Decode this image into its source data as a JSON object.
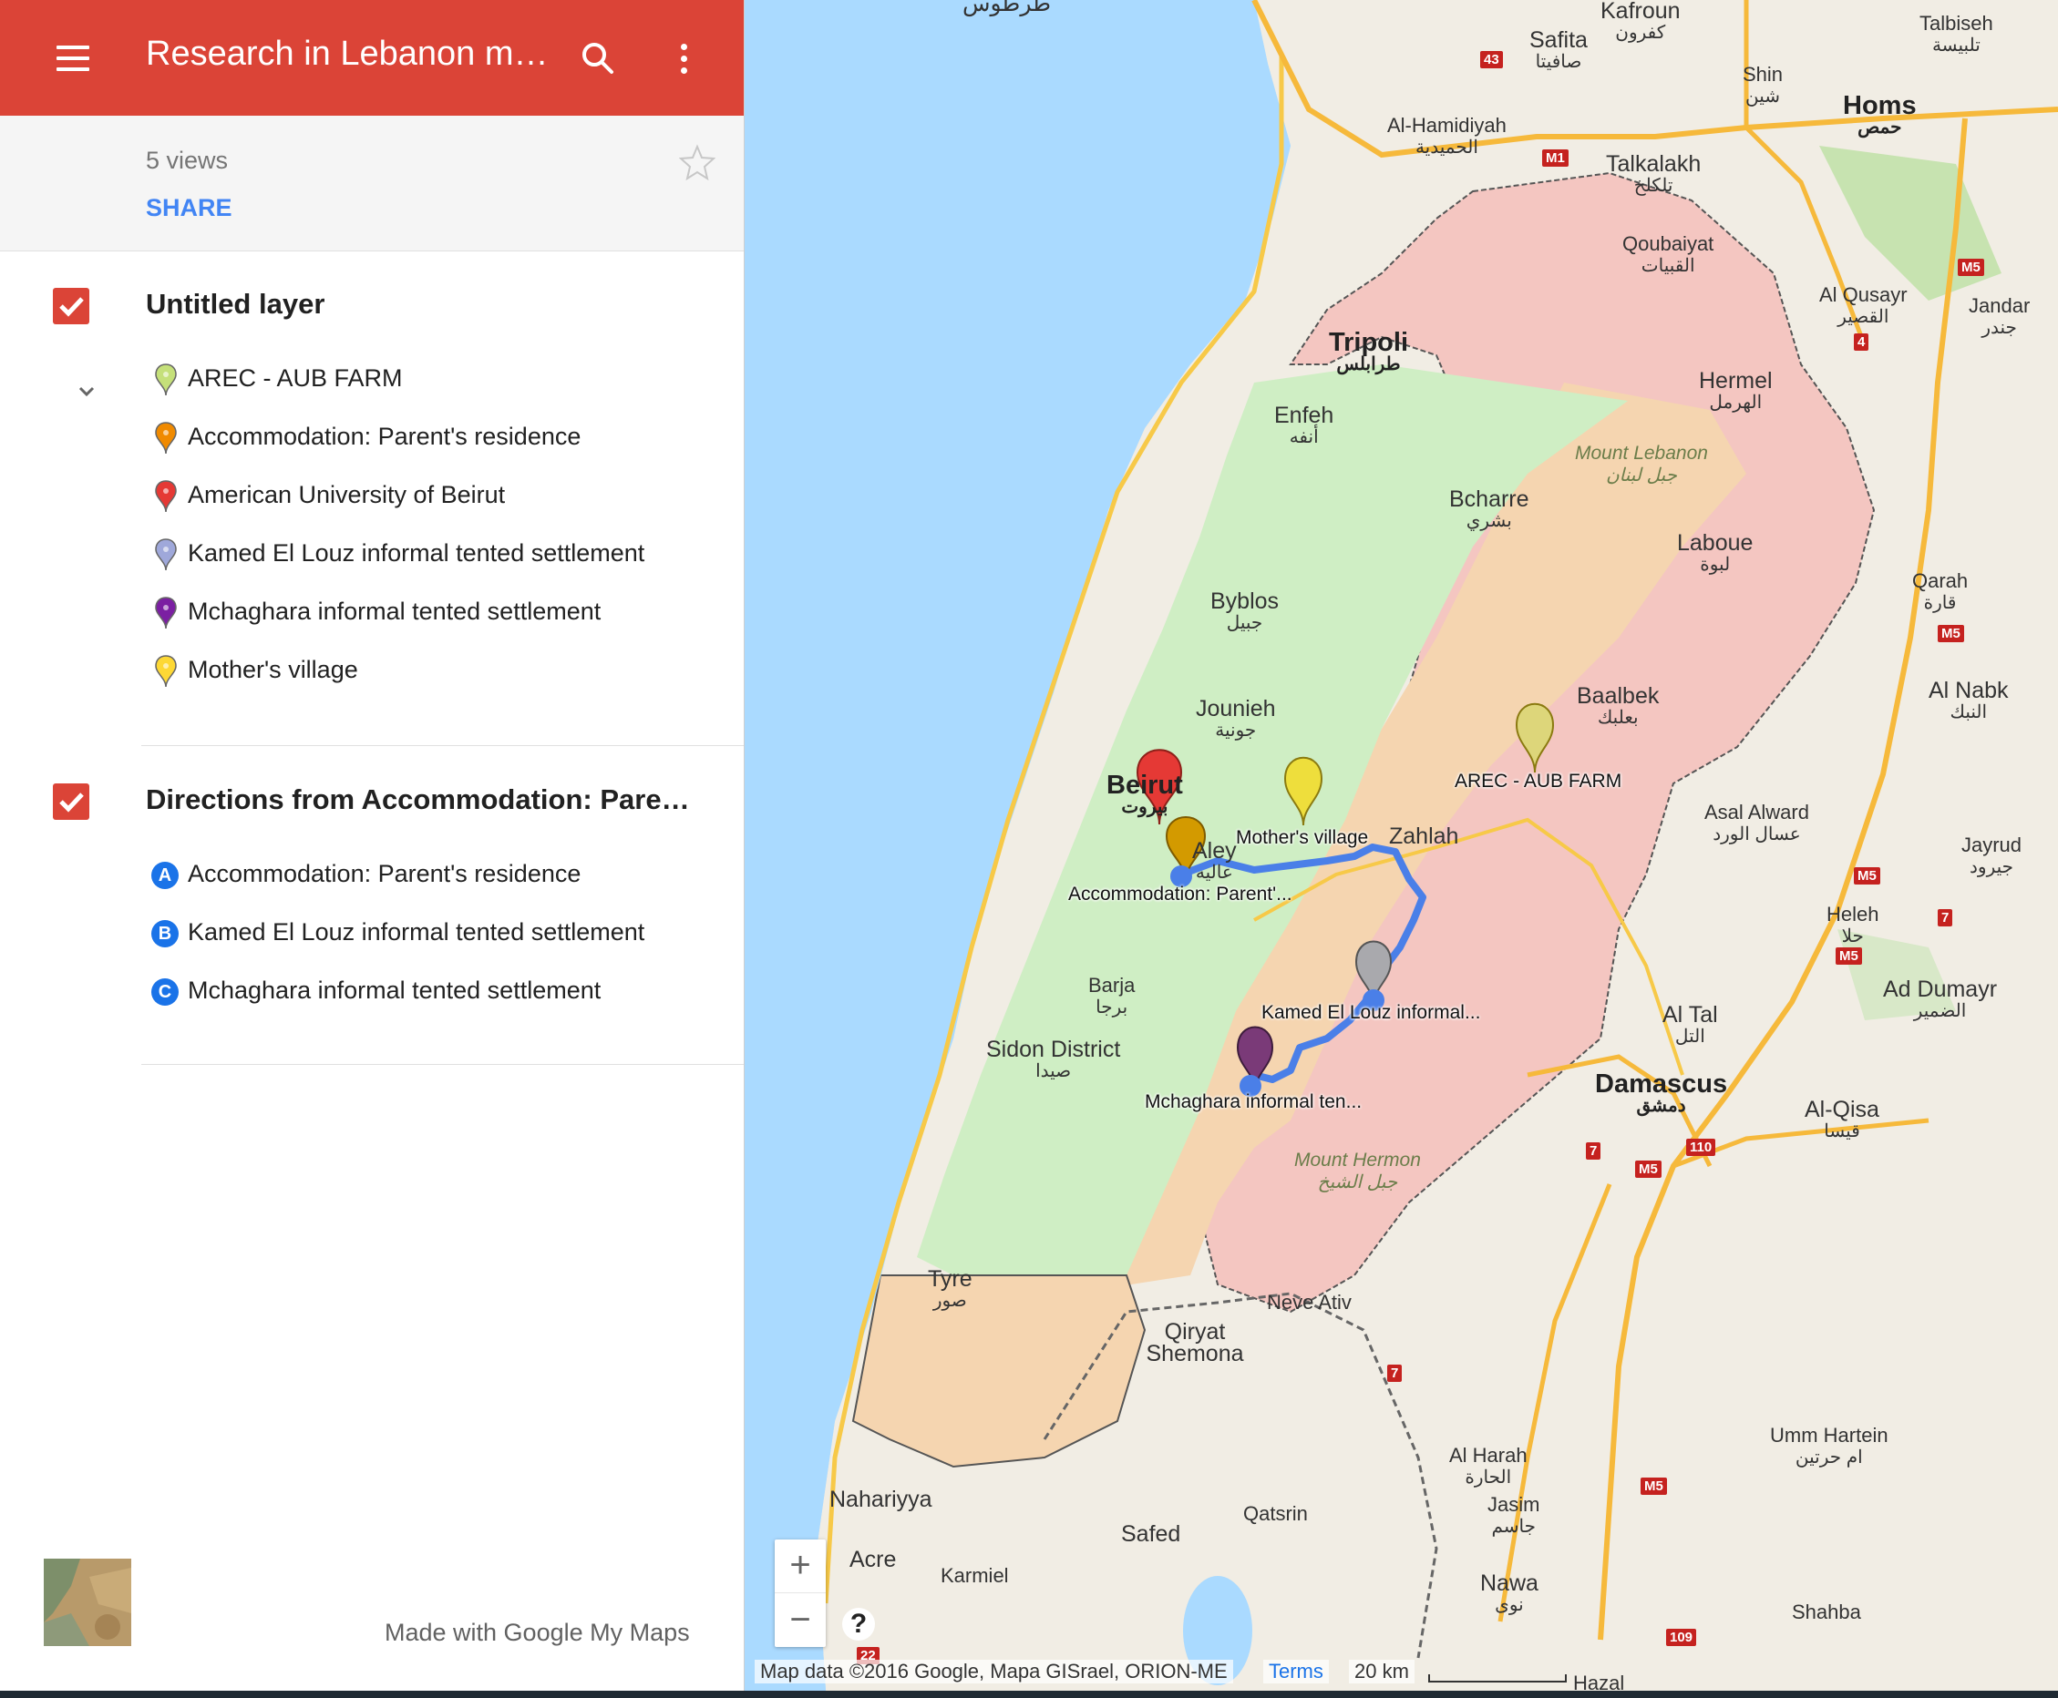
{
  "header": {
    "title": "Research in Lebanon map"
  },
  "meta": {
    "views": "5 views",
    "share_label": "SHARE"
  },
  "layers": [
    {
      "title": "Untitled layer",
      "items": [
        {
          "label": "AREC - AUB FARM",
          "color": "#c5e07a"
        },
        {
          "label": "Accommodation: Parent's residence",
          "color": "#f08a00"
        },
        {
          "label": "American University of Beirut",
          "color": "#e53935"
        },
        {
          "label": "Kamed El Louz informal tented settlement",
          "color": "#9fa8da"
        },
        {
          "label": "Mchaghara informal tented settlement",
          "color": "#7b1fa2"
        },
        {
          "label": "Mother's village",
          "color": "#fdd835"
        }
      ]
    },
    {
      "title": "Directions from Accommodation: Parent's residence",
      "items": [
        {
          "letter": "A",
          "label": "Accommodation: Parent's residence"
        },
        {
          "letter": "B",
          "label": "Kamed El Louz informal tented settlement"
        },
        {
          "letter": "C",
          "label": "Mchaghara informal tented settlement"
        }
      ]
    }
  ],
  "footer": {
    "made_with": "Made with Google My Maps"
  },
  "map": {
    "places": {
      "tartus": "طرطوس",
      "kafroun": "Kafroun",
      "kafroun_ar": "كفرون",
      "safita": "Safita",
      "safita_ar": "صافيتا",
      "talbiseh": "Talbiseh",
      "talbiseh_ar": "تلبيسة",
      "shin": "Shin",
      "shin_ar": "شين",
      "homs": "Homs",
      "homs_ar": "حمص",
      "hamidiyah": "Al-Hamidiyah",
      "hamidiyah_ar": "الحميدية",
      "talkalakh": "Talkalakh",
      "talkalakh_ar": "تلكلخ",
      "qoubaiyat": "Qoubaiyat",
      "qoubaiyat_ar": "القبيات",
      "qusayr": "Al Qusayr",
      "qusayr_ar": "القصير",
      "jandar": "Jandar",
      "jandar_ar": "جندر",
      "tripoli": "Tripoli",
      "tripoli_ar": "طرابلس",
      "hermel": "Hermel",
      "hermel_ar": "الهرمل",
      "enfeh": "Enfeh",
      "enfeh_ar": "أنفه",
      "mount_lebanon": "Mount Lebanon",
      "mount_lebanon_ar": "جبل لبنان",
      "bcharre": "Bcharre",
      "bcharre_ar": "بشري",
      "laboue": "Laboue",
      "laboue_ar": "لبوة",
      "qarah": "Qarah",
      "qarah_ar": "قارة",
      "byblos": "Byblos",
      "byblos_ar": "جبيل",
      "baalbek": "Baalbek",
      "baalbek_ar": "بعلبك",
      "nabk": "Al Nabk",
      "nabk_ar": "النبك",
      "jounieh": "Jounieh",
      "jounieh_ar": "جونية",
      "beirut": "Beirut",
      "beirut_ar": "بيروت",
      "aley": "Aley",
      "aley_ar": "عاليه",
      "zahlah": "Zahlah",
      "asal": "Asal Alward",
      "asal_ar": "عسال الورد",
      "jayrud": "Jayrud",
      "jayrud_ar": "جيرود",
      "heleh": "Heleh",
      "heleh_ar": "حلا",
      "barja": "Barja",
      "barja_ar": "برجا",
      "dumayr": "Ad Dumayr",
      "dumayr_ar": "الضمير",
      "sidon": "Sidon District",
      "sidon_ar": "صيدا",
      "altal": "Al Tal",
      "altal_ar": "التل",
      "damascus": "Damascus",
      "damascus_ar": "دمشق",
      "qisa": "Al-Qisa",
      "qisa_ar": "قيسا",
      "hermon": "Mount Hermon",
      "hermon_ar": "جبل الشيخ",
      "tyre": "Tyre",
      "tyre_ar": "صور",
      "neveativ": "Neve Ativ",
      "qiryat": "Qiryat Shemona",
      "harah": "Al Harah",
      "harah_ar": "الحارة",
      "jasim": "Jasim",
      "jasim_ar": "جاسم",
      "ummhartein": "Umm Hartein",
      "ummhartein_ar": "ام حرتين",
      "nahariyya": "Nahariyya",
      "safed": "Safed",
      "qatsrin": "Qatsrin",
      "acre": "Acre",
      "karmiel": "Karmiel",
      "nawa": "Nawa",
      "nawa_ar": "نوى",
      "shahba": "Shahba",
      "ghazal": "Hazal"
    },
    "pin_labels": {
      "arec": "AREC - AUB FARM",
      "mother": "Mother's village",
      "accommodation": "Accommodation: Parent'...",
      "kamed": "Kamed El Louz informal...",
      "mchaghara": "Mchaghara informal ten..."
    },
    "highways": [
      "43",
      "M1",
      "M5",
      "4",
      "M5",
      "M5",
      "7",
      "M5",
      "7",
      "M5",
      "110",
      "7",
      "M5",
      "109",
      "22"
    ],
    "attribution": "Map data ©2016 Google, Mapa GISrael, ORION-ME",
    "terms": "Terms",
    "scale": "20 km",
    "logo": "Google My Maps",
    "zoom_in": "+",
    "zoom_out": "−",
    "help": "?"
  }
}
